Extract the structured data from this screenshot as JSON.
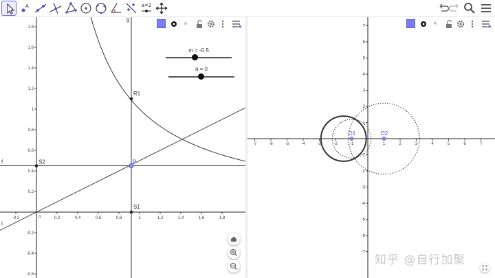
{
  "toolbar": {
    "tools": [
      {
        "name": "move",
        "icon": "cursor-arrow-icon",
        "active": true
      },
      {
        "name": "point",
        "icon": "point-icon"
      },
      {
        "name": "line",
        "icon": "line-icon"
      },
      {
        "name": "perpendicular",
        "icon": "perpendicular-line-icon"
      },
      {
        "name": "polygon",
        "icon": "polygon-icon"
      },
      {
        "name": "circle-center",
        "icon": "circle-icon"
      },
      {
        "name": "circle-three-points",
        "icon": "circle-three-points-icon"
      },
      {
        "name": "angle",
        "icon": "angle-icon"
      },
      {
        "name": "reflect",
        "icon": "reflect-icon"
      },
      {
        "name": "slider",
        "icon": "slider-icon",
        "glyph": "a=2"
      },
      {
        "name": "move-graphics",
        "icon": "move-view-icon"
      }
    ],
    "right": {
      "undo": "undo-icon",
      "redo": "redo-icon",
      "search": "search-icon",
      "menu": "menu-icon"
    }
  },
  "colors": {
    "accent": "#6b68d9",
    "point_blue": "#4d52d8",
    "curve": "#333333"
  },
  "left_view": {
    "x_ticks": [
      "-0.2",
      "0",
      "0.2",
      "0.4",
      "0.6",
      "0.8",
      "1",
      "1.2",
      "1.4",
      "1.6",
      "1.8"
    ],
    "y_ticks": [
      "1.8",
      "1.6",
      "1.4",
      "1.2",
      "1",
      "0.8",
      "0.6",
      "0.4",
      "0.2",
      "-0.2",
      "-0.4",
      "-0.6"
    ],
    "labels": {
      "g": "g",
      "f": "f",
      "l": "l",
      "R1": "R1",
      "P": "P",
      "S1": "S1",
      "S2": "S2"
    },
    "sliders": [
      {
        "label": "m = -0.5",
        "value": -0.5
      },
      {
        "label": "a = 0",
        "value": 0
      }
    ]
  },
  "right_view": {
    "x_ticks": [
      "-7",
      "-6",
      "-5",
      "-4",
      "-3",
      "-2",
      "-1",
      "1",
      "2",
      "3",
      "4",
      "5",
      "6",
      "7"
    ],
    "y_ticks": [
      "7",
      "6",
      "5",
      "4",
      "3",
      "2",
      "1",
      "-1",
      "-2",
      "-3",
      "-4",
      "-5",
      "-6",
      "-7"
    ],
    "labels": {
      "O1": "O1",
      "O2": "O2"
    }
  },
  "stylebar_icons": [
    "color-swatch-icon",
    "point-style-icon",
    "text-size-icon",
    "lock-icon",
    "gear-icon",
    "more-icon",
    "view-menu-icon"
  ],
  "stylebar_text": "A",
  "zoom_icons": [
    "home-icon",
    "zoom-in-icon",
    "zoom-out-icon"
  ],
  "watermark": "知乎 @自行加聚"
}
